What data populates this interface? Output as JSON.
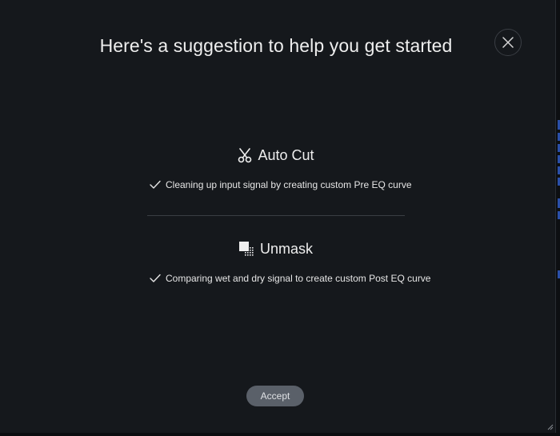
{
  "dialog": {
    "title": "Here's a suggestion to help you get started",
    "close_icon": "close-icon",
    "accept_label": "Accept"
  },
  "sections": [
    {
      "name": "Auto Cut",
      "icon": "scissors-icon",
      "feature": "Cleaning up input signal by creating custom Pre EQ curve",
      "feature_icon": "checkmark-icon"
    },
    {
      "name": "Unmask",
      "icon": "unmask-icon",
      "feature": "Comparing wet and dry signal to create custom Post EQ curve",
      "feature_icon": "checkmark-icon"
    }
  ],
  "colors": {
    "background": "#15181c",
    "text": "#eeeeee",
    "button_bg": "#5a6069",
    "divider": "#3a3e44"
  }
}
